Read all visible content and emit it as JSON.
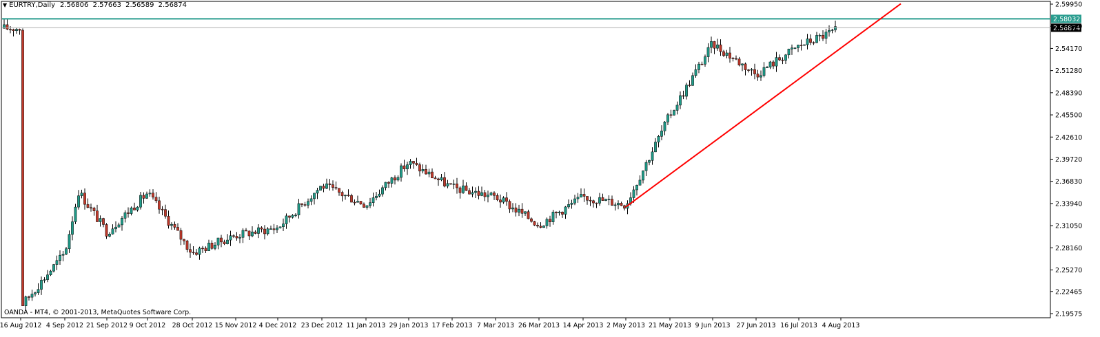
{
  "header": {
    "dropdown_icon": "triangle-down-icon",
    "symbol": "EURTRY,Daily",
    "ohlc": [
      "2.56806",
      "2.57663",
      "2.56589",
      "2.56874"
    ]
  },
  "copyright": "OANDA - MT4, © 2001-2013, MetaQuotes Software Corp.",
  "colors": {
    "bull": "#1f9d8a",
    "bear": "#c0392b",
    "trendline": "#ff0000",
    "hline": "#2a9d8f"
  },
  "chart_data": {
    "type": "candlestick",
    "y_axis": {
      "min": 2.19575,
      "max": 2.5995,
      "side": "right",
      "ticks": [
        "2.59950",
        "2.57060",
        "2.54170",
        "2.51280",
        "2.48390",
        "2.45500",
        "2.42610",
        "2.39720",
        "2.36830",
        "2.33940",
        "2.31050",
        "2.28160",
        "2.25270",
        "2.22465",
        "2.19575"
      ]
    },
    "x_axis": {
      "labels": [
        "16 Aug 2012",
        "4 Sep 2012",
        "21 Sep 2012",
        "9 Oct 2012",
        "28 Oct 2012",
        "15 Nov 2012",
        "4 Dec 2012",
        "23 Dec 2012",
        "11 Jan 2013",
        "29 Jan 2013",
        "17 Feb 2013",
        "7 Mar 2013",
        "26 Mar 2013",
        "14 Apr 2013",
        "2 May 2013",
        "21 May 2013",
        "9 Jun 2013",
        "27 Jun 2013",
        "16 Jul 2013",
        "4 Aug 2013"
      ]
    },
    "price_labels": [
      {
        "value": 2.58032,
        "text": "2.58032",
        "style": "horizontal-line"
      },
      {
        "value": 2.56874,
        "text": "2.56874",
        "style": "current-price"
      }
    ],
    "trendline": {
      "from": {
        "date": "2 May 2013",
        "price": 2.335
      },
      "to": {
        "date": "off-chart-right",
        "price": 2.6
      }
    },
    "close_path": [
      [
        "16 Aug 2012",
        2.205
      ],
      [
        "4 Sep 2012",
        2.275
      ],
      [
        "11 Sep 2012",
        2.355
      ],
      [
        "21 Sep 2012",
        2.302
      ],
      [
        "9 Oct 2012",
        2.353
      ],
      [
        "28 Oct 2012",
        2.275
      ],
      [
        "15 Nov 2012",
        2.298
      ],
      [
        "4 Dec 2012",
        2.308
      ],
      [
        "23 Dec 2012",
        2.363
      ],
      [
        "11 Jan 2013",
        2.338
      ],
      [
        "29 Jan 2013",
        2.393
      ],
      [
        "17 Feb 2013",
        2.36
      ],
      [
        "7 Mar 2013",
        2.348
      ],
      [
        "26 Mar 2013",
        2.312
      ],
      [
        "14 Apr 2013",
        2.348
      ],
      [
        "2 May 2013",
        2.338
      ],
      [
        "21 May 2013",
        2.455
      ],
      [
        "9 Jun 2013",
        2.548
      ],
      [
        "27 Jun 2013",
        2.508
      ],
      [
        "16 Jul 2013",
        2.545
      ],
      [
        "4 Aug 2013",
        2.568
      ]
    ]
  }
}
